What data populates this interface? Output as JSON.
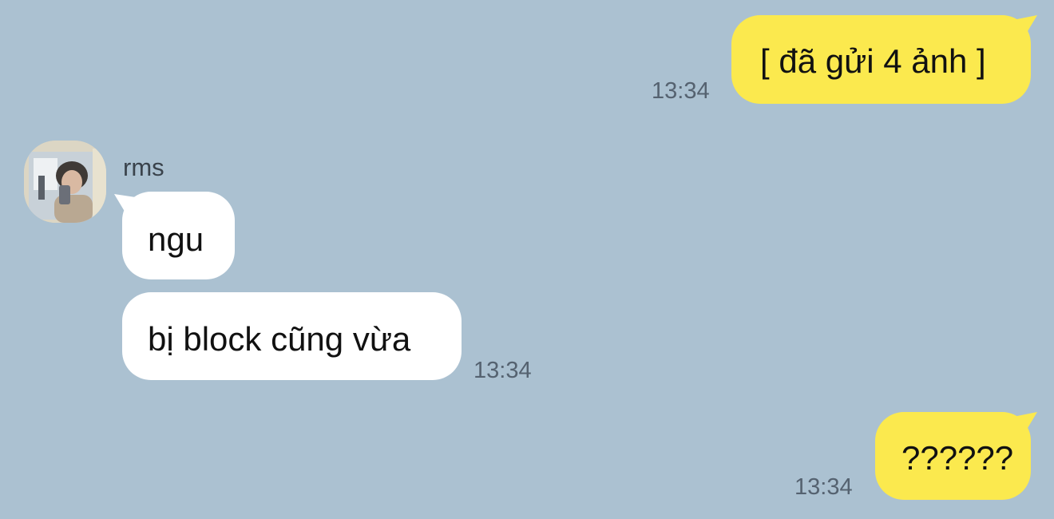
{
  "chat": {
    "contact_name": "rms",
    "colors": {
      "background": "#abc1d1",
      "sent_bubble": "#fbe94e",
      "received_bubble": "#ffffff"
    },
    "messages": [
      {
        "sender": "me",
        "text": "[ đã gửi 4 ảnh ]",
        "time": "13:34"
      },
      {
        "sender": "rms",
        "text": "ngu",
        "time": ""
      },
      {
        "sender": "rms",
        "text": "bị block cũng vừa",
        "time": "13:34"
      },
      {
        "sender": "me",
        "text": "??????",
        "time": "13:34"
      }
    ]
  }
}
